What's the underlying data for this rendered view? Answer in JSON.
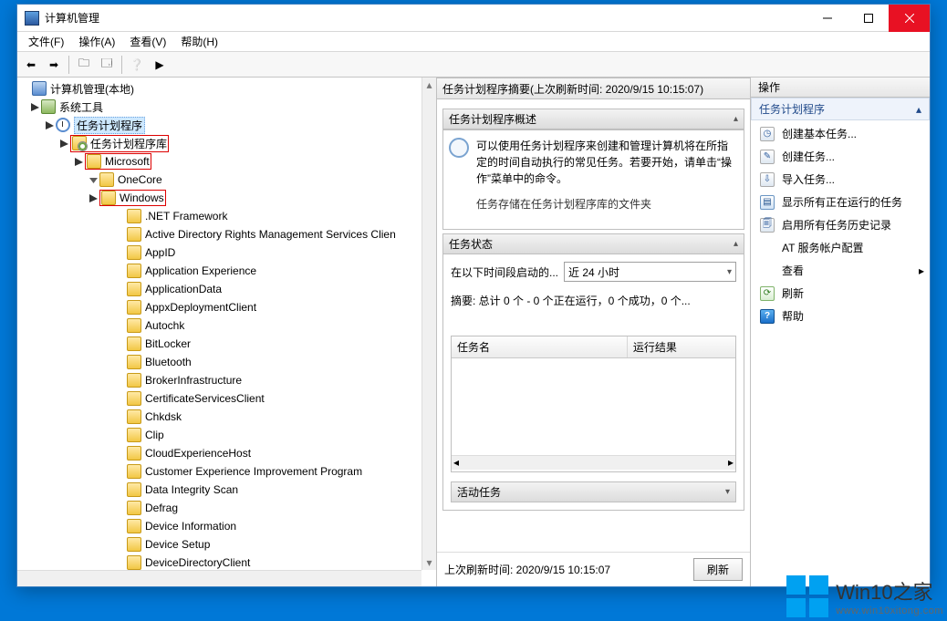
{
  "titlebar": {
    "title": "计算机管理"
  },
  "menubar": [
    "文件(F)",
    "操作(A)",
    "查看(V)",
    "帮助(H)"
  ],
  "tree": {
    "root": "计算机管理(本地)",
    "l1": "系统工具",
    "l2": "任务计划程序",
    "l3": "任务计划程序库",
    "l4": "Microsoft",
    "onecore": "OneCore",
    "windows": "Windows",
    "children": [
      ".NET Framework",
      "Active Directory Rights Management Services Clien",
      "AppID",
      "Application Experience",
      "ApplicationData",
      "AppxDeploymentClient",
      "Autochk",
      "BitLocker",
      "Bluetooth",
      "BrokerInfrastructure",
      "CertificateServicesClient",
      "Chkdsk",
      "Clip",
      "CloudExperienceHost",
      "Customer Experience Improvement Program",
      "Data Integrity Scan",
      "Defrag",
      "Device Information",
      "Device Setup",
      "DeviceDirectoryClient"
    ]
  },
  "mid": {
    "title": "任务计划程序摘要(上次刷新时间: 2020/9/15 10:15:07)",
    "overviewHead": "任务计划程序概述",
    "overviewText": "可以使用任务计划程序来创建和管理计算机将在所指定的时间自动执行的常见任务。若要开始，请单击“操作”菜单中的命令。",
    "overviewText2": "任务存储在任务计划程序库的文件夹",
    "statusHead": "任务状态",
    "statusLabel": "在以下时间段启动的...",
    "statusRange": "近 24 小时",
    "summary": "摘要: 总计 0 个 - 0 个正在运行，0 个成功，0 个...",
    "colName": "任务名",
    "colResult": "运行结果",
    "activeHead": "活动任务",
    "lastRefresh": "上次刷新时间: 2020/9/15 10:15:07",
    "refreshBtn": "刷新"
  },
  "actions": {
    "header": "操作",
    "group": "任务计划程序",
    "items": {
      "a1": "创建基本任务...",
      "a2": "创建任务...",
      "a3": "导入任务...",
      "a4": "显示所有正在运行的任务",
      "a5": "启用所有任务历史记录",
      "a6": "AT 服务帐户配置",
      "a7": "查看",
      "a8": "刷新",
      "a9": "帮助"
    }
  },
  "watermark": {
    "brand": "Win10之家",
    "url": "www.win10xitong.com"
  }
}
